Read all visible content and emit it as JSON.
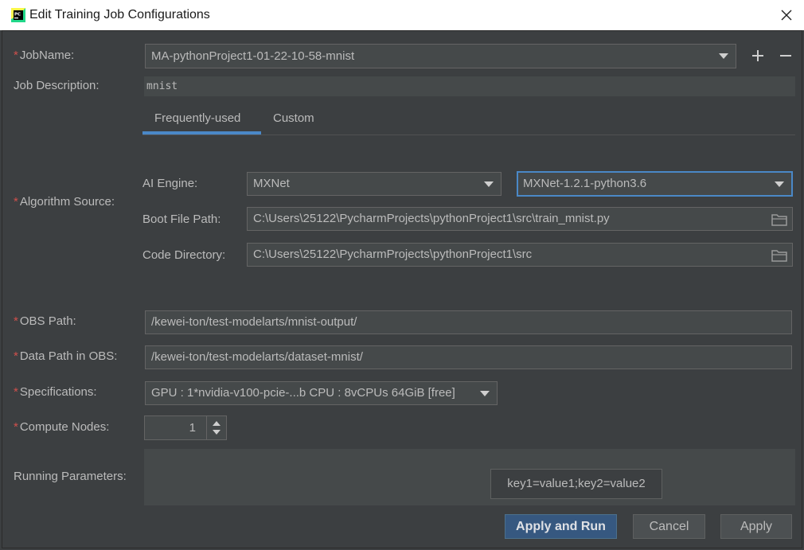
{
  "window": {
    "title": "Edit Training Job Configurations"
  },
  "form": {
    "job_name": {
      "label": "JobName:",
      "value": "MA-pythonProject1-01-22-10-58-mnist"
    },
    "job_description": {
      "label": "Job Description:",
      "value": "mnist"
    },
    "tabs": [
      {
        "label": "Frequently-used"
      },
      {
        "label": "Custom"
      }
    ],
    "algorithm_source": {
      "label": "Algorithm Source:",
      "ai_engine": {
        "label": "AI Engine:",
        "value": "MXNet",
        "version": "MXNet-1.2.1-python3.6"
      },
      "boot_file": {
        "label": "Boot File Path:",
        "value": "C:\\Users\\25122\\PycharmProjects\\pythonProject1\\src\\train_mnist.py"
      },
      "code_dir": {
        "label": "Code Directory:",
        "value": "C:\\Users\\25122\\PycharmProjects\\pythonProject1\\src"
      }
    },
    "obs_path": {
      "label": "OBS Path:",
      "value": "/kewei-ton/test-modelarts/mnist-output/"
    },
    "data_path": {
      "label": "Data Path in OBS:",
      "value": "/kewei-ton/test-modelarts/dataset-mnist/"
    },
    "specifications": {
      "label": "Specifications:",
      "value": "GPU : 1*nvidia-v100-pcie-...b CPU : 8vCPUs 64GiB [free]"
    },
    "compute_nodes": {
      "label": "Compute Nodes:",
      "value": "1"
    },
    "running_params": {
      "label": "Running Parameters:",
      "hint": "key1=value1;key2=value2"
    }
  },
  "buttons": {
    "apply_run": "Apply and Run",
    "cancel": "Cancel",
    "apply": "Apply"
  },
  "required_marker": "*",
  "icons": {
    "add": "plus-icon",
    "remove": "minus-icon",
    "browse": "folder-icon",
    "close": "close-icon",
    "app": "pycharm-icon"
  },
  "colors": {
    "accent": "#4a88c7",
    "primary_button": "#365880",
    "required": "#d0504c",
    "background": "#3c3f41"
  }
}
